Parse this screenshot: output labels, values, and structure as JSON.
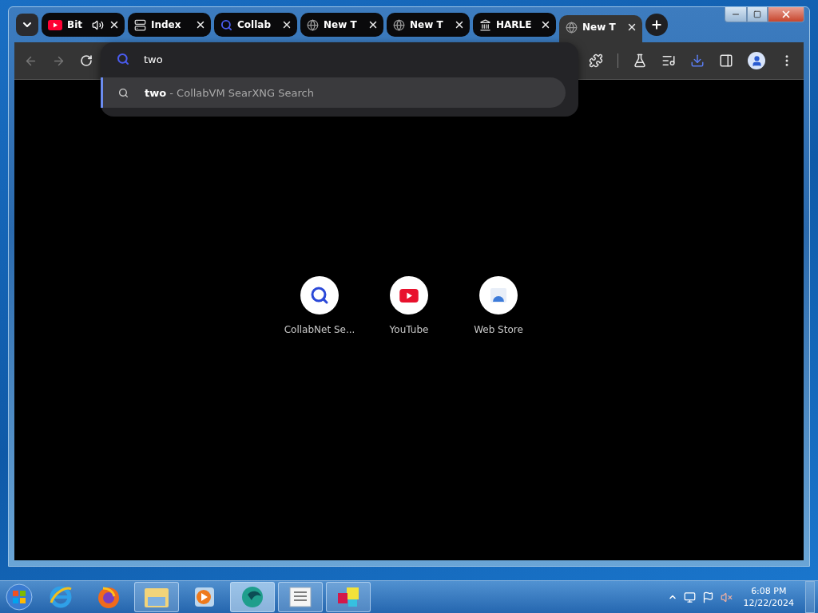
{
  "tabs": [
    {
      "title": "Bit",
      "kind": "youtube",
      "audio": true,
      "selected": false
    },
    {
      "title": "Index",
      "kind": "server",
      "audio": false,
      "selected": false
    },
    {
      "title": "Collab",
      "kind": "search",
      "audio": false,
      "selected": false
    },
    {
      "title": "New T",
      "kind": "globe",
      "audio": false,
      "selected": false
    },
    {
      "title": "New T",
      "kind": "globe",
      "audio": false,
      "selected": false
    },
    {
      "title": "HARLE",
      "kind": "museum",
      "audio": false,
      "selected": false
    },
    {
      "title": "New T",
      "kind": "globe",
      "audio": false,
      "selected": true
    }
  ],
  "omnibox": {
    "value": "two"
  },
  "suggestion": {
    "text": "**two** - CollabVM SearXNG Search",
    "selected": true
  },
  "shortcuts": [
    {
      "label": "CollabNet Se...",
      "kind": "search"
    },
    {
      "label": "YouTube",
      "kind": "youtube"
    },
    {
      "label": "Web Store",
      "kind": "store"
    }
  ],
  "taskbar": {
    "apps": [
      {
        "kind": "ie",
        "running": false,
        "selected": false
      },
      {
        "kind": "firefox",
        "running": false,
        "selected": false
      },
      {
        "kind": "explorer",
        "running": true,
        "selected": false
      },
      {
        "kind": "media",
        "running": false,
        "selected": false
      },
      {
        "kind": "browser",
        "running": true,
        "selected": true
      },
      {
        "kind": "notepad",
        "running": true,
        "selected": false
      },
      {
        "kind": "paint",
        "running": true,
        "selected": false
      }
    ],
    "time": "6:08 PM",
    "date": "12/22/2024"
  }
}
